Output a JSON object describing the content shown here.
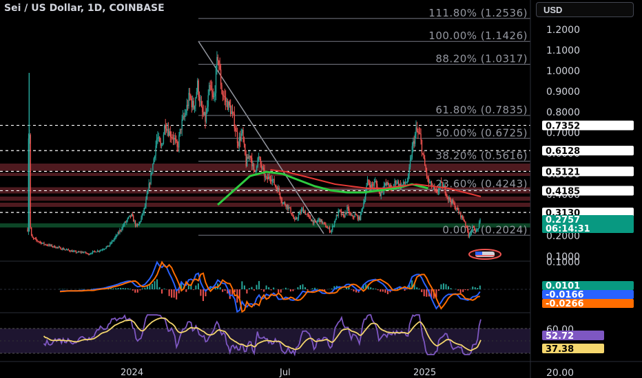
{
  "header": {
    "title": "Sei / US Dollar, 1D, COINBASE",
    "currency_button": "USD"
  },
  "colors": {
    "up": "#26a69a",
    "down": "#ef5350",
    "ema_green": "#2ecc40",
    "ema_red": "#e53935",
    "macd": "#2962ff",
    "signal": "#ff6d00",
    "rsi": "#7e57c2",
    "rsi_ma": "#f5d76e",
    "tag_green": "#089981",
    "tag_blue": "#2962ff",
    "tag_orange": "#ff6d00",
    "tag_purple": "#7e57c2",
    "tag_yellow": "#f5d76e",
    "zone_red": "#5c1e24",
    "zone_green": "#0d4d2a"
  },
  "chart_data": [
    {
      "type": "candlestick",
      "title": "Sei / US Dollar, 1D, COINBASE",
      "y_axis": {
        "ticks": [
          "1.2000",
          "1.1000",
          "1.0000",
          "0.9000",
          "0.8000",
          "0.7000",
          "0.6000",
          "0.5000",
          "0.4000",
          "0.3000",
          "0.2000",
          "0.1000"
        ],
        "ylim": [
          0.1,
          1.25
        ]
      },
      "x_axis": {
        "ticks": [
          "2024",
          "Jul",
          "2025"
        ]
      },
      "price_path": [
        [
          0,
          0.23
        ],
        [
          2,
          0.99
        ],
        [
          3,
          0.26
        ],
        [
          5,
          0.19
        ],
        [
          10,
          0.18
        ],
        [
          20,
          0.16
        ],
        [
          30,
          0.15
        ],
        [
          40,
          0.14
        ],
        [
          50,
          0.13
        ],
        [
          60,
          0.12
        ],
        [
          70,
          0.12
        ],
        [
          75,
          0.11
        ],
        [
          80,
          0.12
        ],
        [
          90,
          0.13
        ],
        [
          100,
          0.15
        ],
        [
          110,
          0.2
        ],
        [
          120,
          0.26
        ],
        [
          128,
          0.3
        ],
        [
          135,
          0.24
        ],
        [
          140,
          0.28
        ],
        [
          145,
          0.34
        ],
        [
          150,
          0.44
        ],
        [
          155,
          0.55
        ],
        [
          160,
          0.68
        ],
        [
          165,
          0.62
        ],
        [
          170,
          0.75
        ],
        [
          175,
          0.7
        ],
        [
          180,
          0.68
        ],
        [
          185,
          0.62
        ],
        [
          190,
          0.74
        ],
        [
          195,
          0.79
        ],
        [
          200,
          0.88
        ],
        [
          205,
          0.82
        ],
        [
          210,
          0.93
        ],
        [
          215,
          0.8
        ],
        [
          220,
          0.76
        ],
        [
          225,
          0.92
        ],
        [
          230,
          0.85
        ],
        [
          235,
          1.08
        ],
        [
          240,
          0.9
        ],
        [
          245,
          0.85
        ],
        [
          250,
          0.82
        ],
        [
          255,
          0.76
        ],
        [
          260,
          0.65
        ],
        [
          265,
          0.7
        ],
        [
          270,
          0.55
        ],
        [
          275,
          0.6
        ],
        [
          280,
          0.5
        ],
        [
          285,
          0.58
        ],
        [
          290,
          0.52
        ],
        [
          295,
          0.47
        ],
        [
          300,
          0.49
        ],
        [
          305,
          0.45
        ],
        [
          310,
          0.42
        ],
        [
          315,
          0.36
        ],
        [
          320,
          0.35
        ],
        [
          325,
          0.32
        ],
        [
          330,
          0.27
        ],
        [
          335,
          0.3
        ],
        [
          340,
          0.33
        ],
        [
          345,
          0.3
        ],
        [
          350,
          0.28
        ],
        [
          355,
          0.26
        ],
        [
          360,
          0.28
        ],
        [
          365,
          0.26
        ],
        [
          370,
          0.24
        ],
        [
          375,
          0.22
        ],
        [
          380,
          0.28
        ],
        [
          385,
          0.32
        ],
        [
          390,
          0.29
        ],
        [
          395,
          0.33
        ],
        [
          400,
          0.29
        ],
        [
          405,
          0.3
        ],
        [
          410,
          0.28
        ],
        [
          415,
          0.36
        ],
        [
          420,
          0.46
        ],
        [
          425,
          0.44
        ],
        [
          430,
          0.46
        ],
        [
          435,
          0.4
        ],
        [
          440,
          0.44
        ],
        [
          445,
          0.45
        ],
        [
          450,
          0.42
        ],
        [
          455,
          0.47
        ],
        [
          460,
          0.44
        ],
        [
          465,
          0.45
        ],
        [
          470,
          0.47
        ],
        [
          475,
          0.62
        ],
        [
          480,
          0.71
        ],
        [
          485,
          0.68
        ],
        [
          490,
          0.55
        ],
        [
          495,
          0.46
        ],
        [
          500,
          0.44
        ],
        [
          505,
          0.4
        ],
        [
          510,
          0.45
        ],
        [
          515,
          0.43
        ],
        [
          520,
          0.38
        ],
        [
          525,
          0.36
        ],
        [
          530,
          0.33
        ],
        [
          535,
          0.3
        ],
        [
          540,
          0.27
        ],
        [
          545,
          0.2
        ],
        [
          550,
          0.24
        ],
        [
          555,
          0.22
        ],
        [
          560,
          0.28
        ]
      ],
      "fib_levels": [
        {
          "label": "111.80% (1.2536)",
          "value": 1.2536
        },
        {
          "label": "100.00% (1.1426)",
          "value": 1.1426
        },
        {
          "label": "88.20% (1.0317)",
          "value": 1.0317
        },
        {
          "label": "61.80% (0.7835)",
          "value": 0.7835
        },
        {
          "label": "50.00% (0.6725)",
          "value": 0.6725
        },
        {
          "label": "38.20% (0.5616)",
          "value": 0.5616
        },
        {
          "label": "23.60% (0.4243)",
          "value": 0.4243
        },
        {
          "label": "0.00% (0.2024)",
          "value": 0.2024
        }
      ],
      "horizontal_levels": [
        "0.7352",
        "0.6128",
        "0.5121",
        "0.4185",
        "0.3130"
      ],
      "last_price": "0.2757",
      "countdown": "06:14:31"
    },
    {
      "type": "line",
      "name_hidden": true,
      "y_axis": {
        "ticks": [
          "0.1000"
        ]
      },
      "values": {
        "histogram": "0.0101",
        "macd": "-0.0166",
        "signal": "-0.0266"
      }
    },
    {
      "type": "line",
      "y_axis": {
        "ticks": [
          "60.00",
          "20.00"
        ],
        "ylim": [
          20,
          80
        ]
      },
      "values": {
        "rsi": "52.72",
        "rsi_ma": "37.38"
      }
    }
  ]
}
